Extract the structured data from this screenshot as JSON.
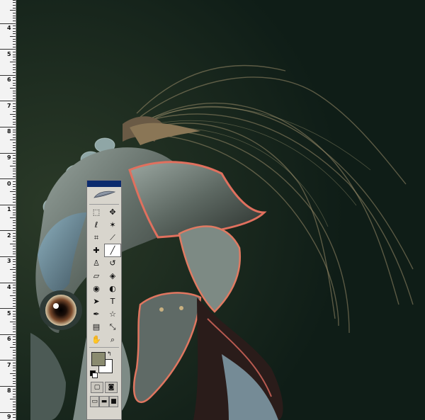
{
  "ruler": {
    "labels": [
      "4",
      "5",
      "6",
      "7",
      "8",
      "9",
      "0",
      "1",
      "2",
      "3",
      "4",
      "5",
      "6",
      "7",
      "8",
      "9"
    ]
  },
  "palette": {
    "tools": [
      {
        "icon": "marquee-icon",
        "glyph": "⬚"
      },
      {
        "icon": "move-icon",
        "glyph": "✥"
      },
      {
        "icon": "lasso-icon",
        "glyph": "ℓ"
      },
      {
        "icon": "magic-wand-icon",
        "glyph": "✶"
      },
      {
        "icon": "crop-icon",
        "glyph": "⌗"
      },
      {
        "icon": "slice-icon",
        "glyph": "⟋"
      },
      {
        "icon": "healing-brush-icon",
        "glyph": "✚"
      },
      {
        "icon": "brush-icon",
        "glyph": "╱"
      },
      {
        "icon": "clone-stamp-icon",
        "glyph": "♙"
      },
      {
        "icon": "history-brush-icon",
        "glyph": "↺"
      },
      {
        "icon": "eraser-icon",
        "glyph": "▱"
      },
      {
        "icon": "paint-bucket-icon",
        "glyph": "◈"
      },
      {
        "icon": "blur-icon",
        "glyph": "◉"
      },
      {
        "icon": "dodge-icon",
        "glyph": "◐"
      },
      {
        "icon": "path-selection-icon",
        "glyph": "➤"
      },
      {
        "icon": "type-icon",
        "glyph": "T"
      },
      {
        "icon": "pen-icon",
        "glyph": "✒"
      },
      {
        "icon": "shape-icon",
        "glyph": "☆"
      },
      {
        "icon": "notes-icon",
        "glyph": "▤"
      },
      {
        "icon": "eyedropper-icon",
        "glyph": "⤡"
      },
      {
        "icon": "hand-icon",
        "glyph": "✋"
      },
      {
        "icon": "zoom-icon",
        "glyph": "⌕"
      }
    ],
    "active_tool": "brush-icon",
    "foreground_color": "#8a8b6f",
    "background_color": "#ffffff"
  }
}
